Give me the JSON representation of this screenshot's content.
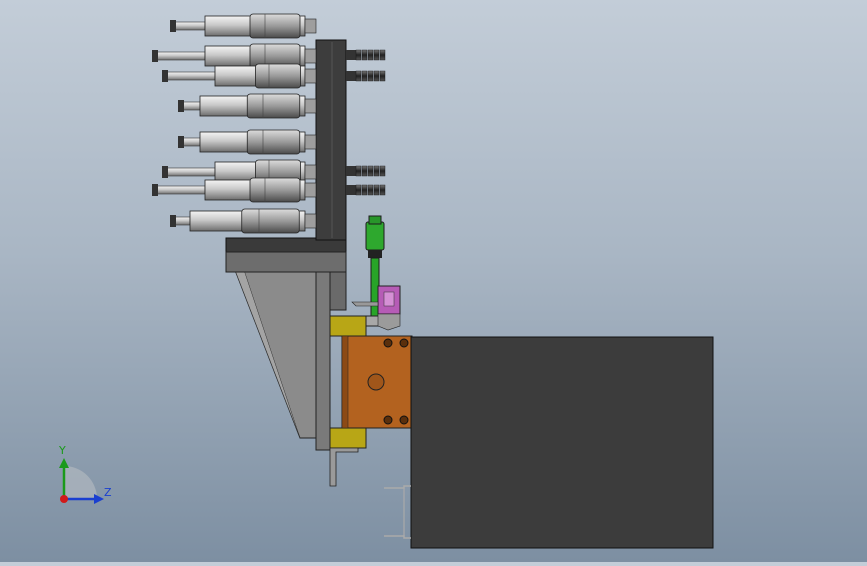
{
  "viewport": {
    "background_top": "#c3cdd8",
    "background_bottom": "#7d8fa2"
  },
  "triad": {
    "y_label": "Y",
    "z_label": "Z",
    "y_color": "#1a9a1a",
    "z_color": "#1a3fd0",
    "x_color": "#d01a1a"
  },
  "colors": {
    "dark_block": "#3c3c3c",
    "plate": "#6f6f6f",
    "gusset": "#8a8a8a",
    "brown_block": "#b0601e",
    "yellow_bracket": "#b3a418",
    "green_part": "#26a626",
    "purple_part": "#b457b4",
    "cylinder": "#c9c9c9"
  }
}
